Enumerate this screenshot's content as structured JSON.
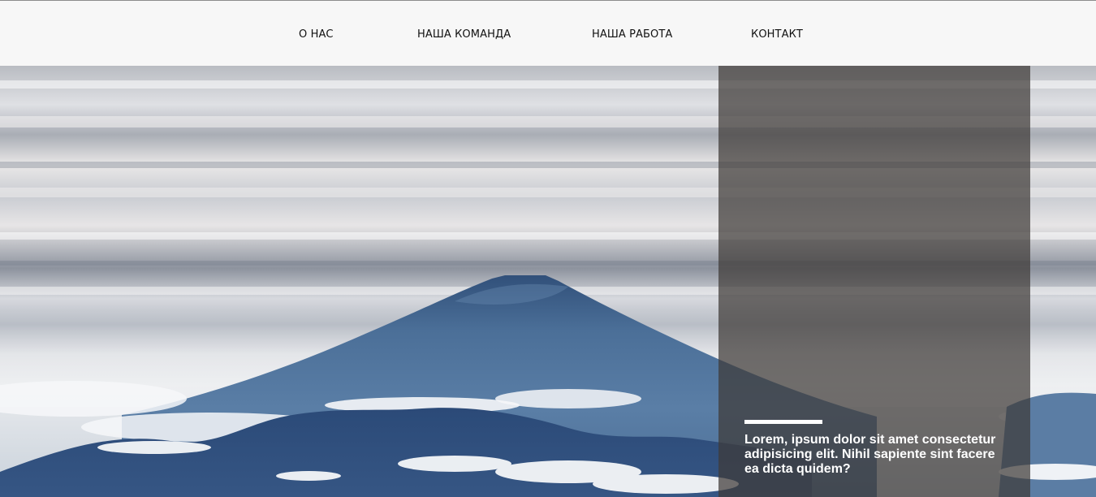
{
  "nav": {
    "items": [
      {
        "label": "О НАС"
      },
      {
        "label": "НАША КОМАНДА"
      },
      {
        "label": "НАША РАБОТА"
      },
      {
        "label": "КОНТАКТ"
      }
    ]
  },
  "hero": {
    "image": "mountain-above-clouds",
    "overlay": {
      "text": "Lorem, ipsum dolor sit amet consectetur adipisicing elit. Nihil sapiente sint facere ea dicta quidem?",
      "panel_color": "#3e3a38",
      "accent_color": "#ffffff"
    }
  },
  "colors": {
    "nav_background": "#f7f7f7",
    "nav_text": "#111111",
    "mountain": "#4a6f97"
  }
}
